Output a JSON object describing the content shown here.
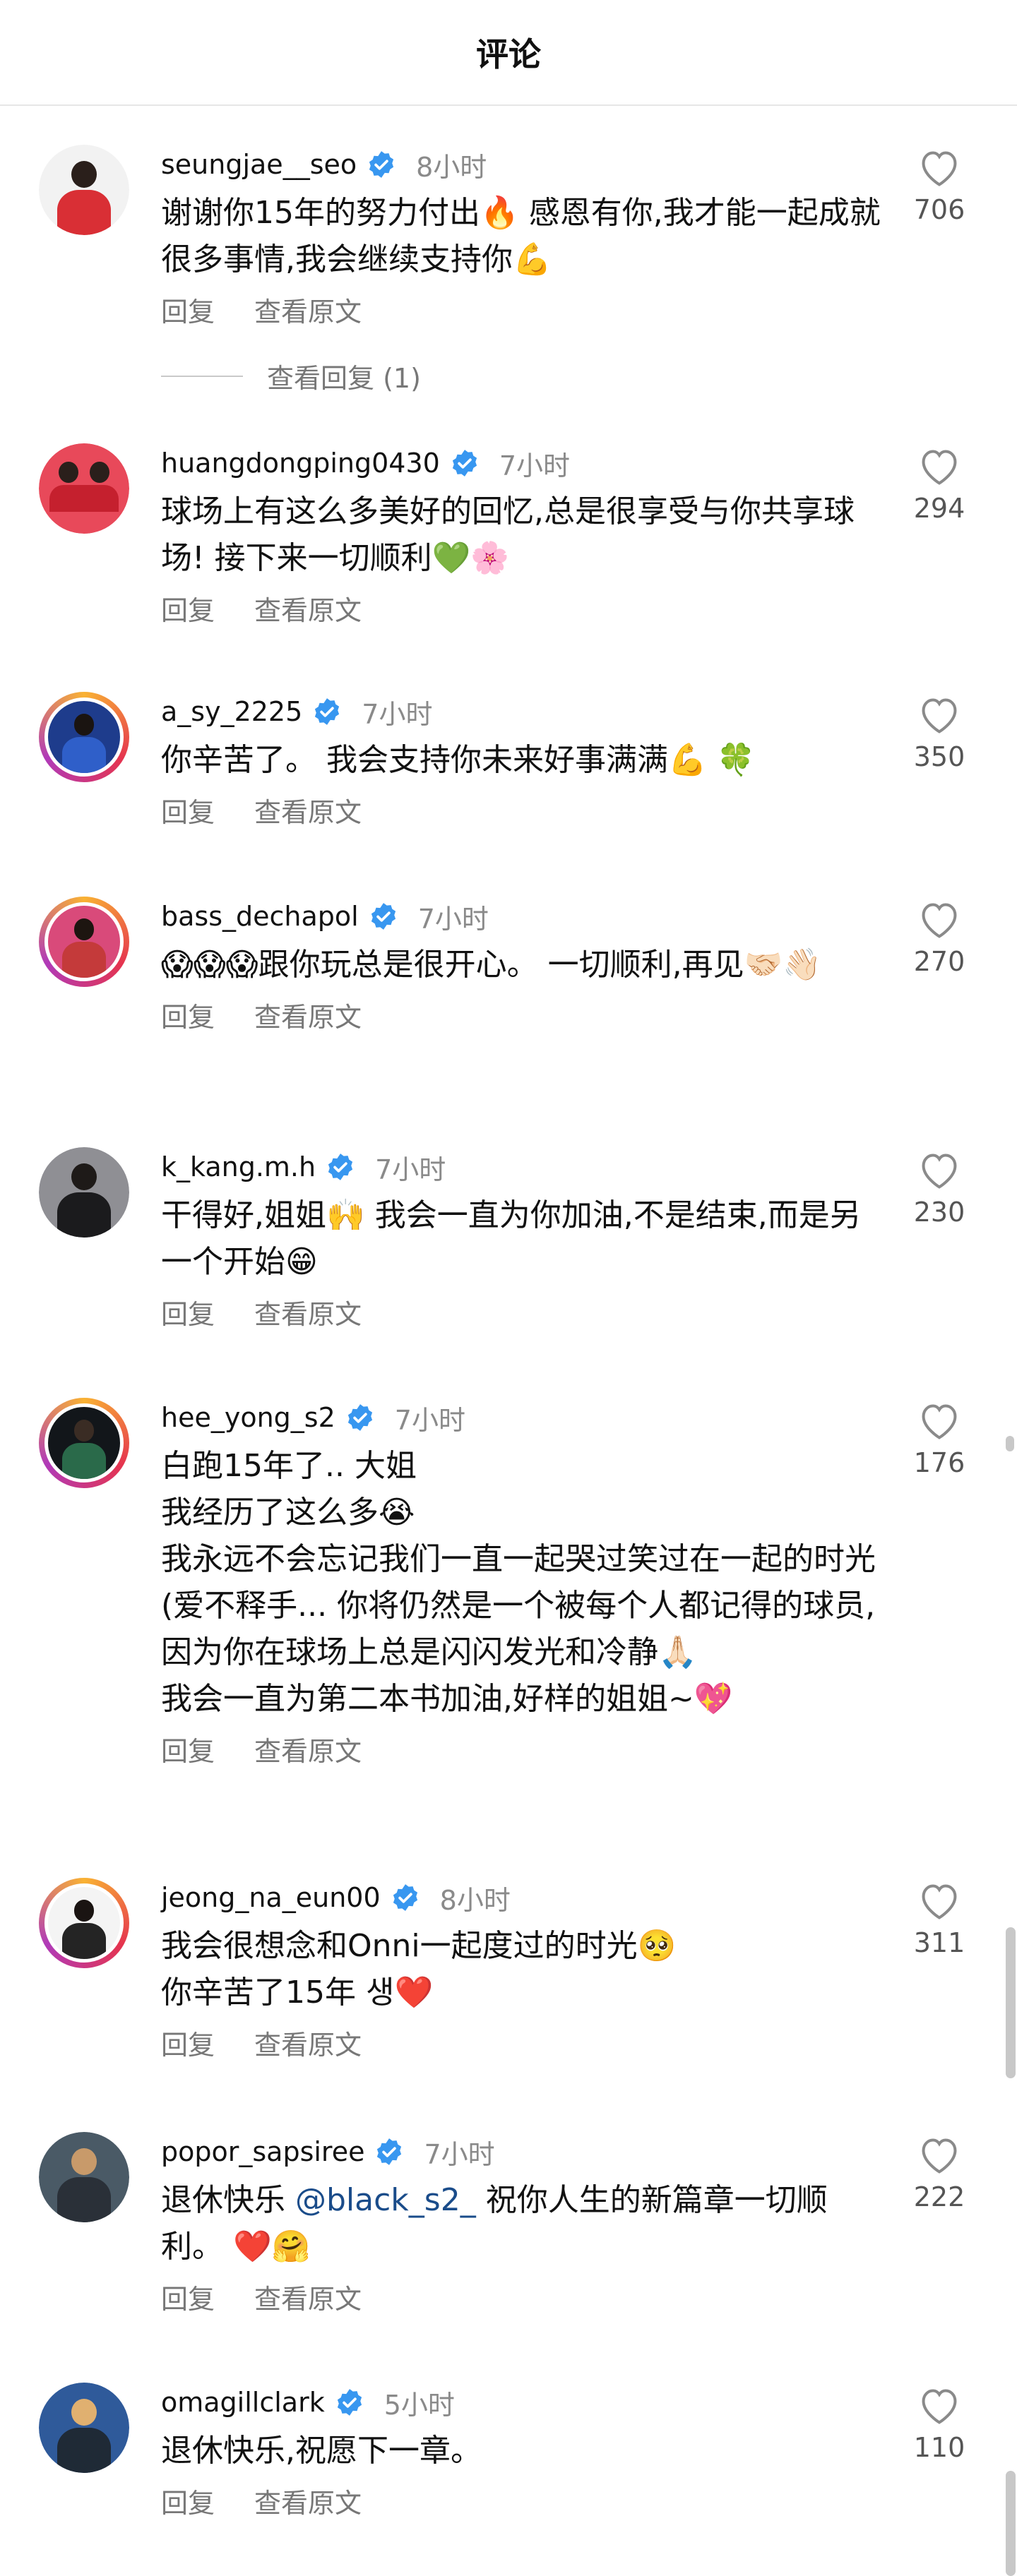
{
  "header": {
    "title": "评论"
  },
  "comments": [
    {
      "username": "seungjae__seo",
      "time": "8小时",
      "text": "谢谢你15年的努力付出🔥 感恩有你,我才能一起成就很多事情,我会继续支持你💪",
      "likes": "706",
      "reply": "回复",
      "original": "查看原文",
      "view_replies": "查看回复 (1)"
    },
    {
      "username": "huangdongping0430",
      "time": "7小时",
      "text": "球场上有这么多美好的回忆,总是很享受与你共享球场! 接下来一切顺利💚🌸",
      "likes": "294",
      "reply": "回复",
      "original": "查看原文"
    },
    {
      "username": "a_sy_2225",
      "time": "7小时",
      "text": "你辛苦了。 我会支持你未来好事满满💪 🍀",
      "likes": "350",
      "reply": "回复",
      "original": "查看原文"
    },
    {
      "username": "bass_dechapol",
      "time": "7小时",
      "text": "😱😱😱跟你玩总是很开心。 一切顺利,再见🤝🏻👋🏻",
      "likes": "270",
      "reply": "回复",
      "original": "查看原文"
    },
    {
      "username": "k_kang.m.h",
      "time": "7小时",
      "text": "干得好,姐姐🙌 我会一直为你加油,不是结束,而是另一个开始😁",
      "likes": "230",
      "reply": "回复",
      "original": "查看原文"
    },
    {
      "username": "hee_yong_s2",
      "time": "7小时",
      "text": "白跑15年了.. 大姐\n我经历了这么多😭\n我永远不会忘记我们一直一起哭过笑过在一起的时光(爱不释手... 你将仍然是一个被每个人都记得的球员,因为你在球场上总是闪闪发光和冷静🙏🏻\n我会一直为第二本书加油,好样的姐姐~💖",
      "likes": "176",
      "reply": "回复",
      "original": "查看原文"
    },
    {
      "username": "jeong_na_eun00",
      "time": "8小时",
      "text": "我会很想念和Onni一起度过的时光🥺\n你辛苦了15年 생❤️",
      "likes": "311",
      "reply": "回复",
      "original": "查看原文"
    },
    {
      "username": "popor_sapsiree",
      "time": "7小时",
      "text_before": "退休快乐 ",
      "mention": "@black_s2_",
      "text_after": " 祝你人生的新篇章一切顺利。 ❤️🤗",
      "likes": "222",
      "reply": "回复",
      "original": "查看原文"
    },
    {
      "username": "omagillclark",
      "time": "5小时",
      "text": "退休快乐,祝愿下一章。",
      "likes": "110",
      "reply": "回复",
      "original": "查看原文"
    }
  ],
  "colors": {
    "verified": "#3897f0",
    "mention": "#1a4c8a",
    "muted": "#8a8a8a"
  },
  "icons": {
    "verified": "verified-badge-icon",
    "like": "heart-outline-icon"
  }
}
